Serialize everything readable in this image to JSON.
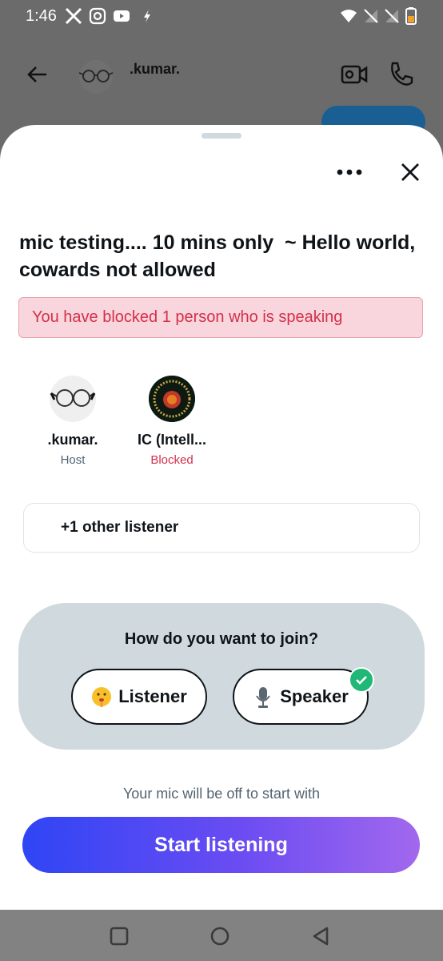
{
  "status_bar": {
    "time": "1:46",
    "icons": [
      "x-icon",
      "instagram-icon",
      "youtube-icon",
      "flash-icon",
      "wifi-icon",
      "signal-icon",
      "signal-icon",
      "battery-icon"
    ]
  },
  "chat_header": {
    "name": ".kumar."
  },
  "sheet": {
    "title": "mic testing.... 10 mins only  ~ Hello world, cowards not allowed",
    "blocked_banner": "You have blocked 1 person who is speaking",
    "participants": [
      {
        "name": ".kumar.",
        "role": "Host",
        "avatar": "glasses-avatar"
      },
      {
        "name": "IC (Intell...",
        "role": "Blocked",
        "avatar": "intellectually-confused-avatar"
      }
    ],
    "listeners": "+1 other listener",
    "join": {
      "question": "How do you want to join?",
      "options": [
        {
          "label": "Listener",
          "icon": "shushing-face-icon",
          "selected": false
        },
        {
          "label": "Speaker",
          "icon": "microphone-icon",
          "selected": true
        }
      ]
    },
    "mic_note": "Your mic will be off to start with",
    "start_button": "Start listening"
  },
  "colors": {
    "blocked": "#d3304a",
    "banner_bg": "#f9d6dd",
    "panel_bg": "#cfd9de",
    "check": "#1fb876",
    "gradient_start": "#2f45f5",
    "gradient_end": "#a268ee"
  }
}
